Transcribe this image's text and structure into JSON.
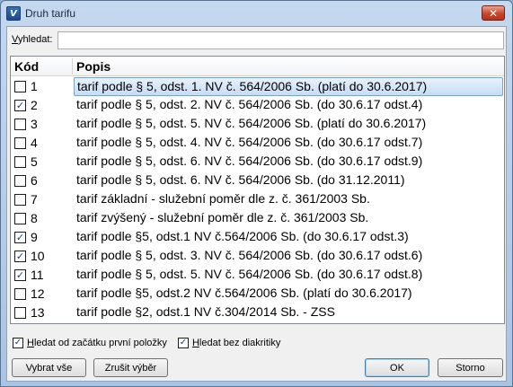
{
  "window": {
    "title": "Druh tarifu",
    "app_icon": "V",
    "close_glyph": "✕"
  },
  "search": {
    "label_prefix": "V",
    "label_rest": "yhledat:",
    "value": ""
  },
  "columns": {
    "kod": "Kód",
    "popis": "Popis"
  },
  "rows": [
    {
      "kod": "1",
      "popis": "tarif podle § 5, odst. 1. NV č. 564/2006 Sb. (platí do 30.6.2017)",
      "checked": false,
      "selected": true
    },
    {
      "kod": "2",
      "popis": "tarif podle § 5, odst. 2. NV č. 564/2006 Sb. (do 30.6.17 odst.4)",
      "checked": true,
      "selected": false
    },
    {
      "kod": "3",
      "popis": "tarif podle § 5, odst. 5. NV č. 564/2006 Sb. (platí do 30.6.2017)",
      "checked": false,
      "selected": false
    },
    {
      "kod": "4",
      "popis": "tarif podle § 5, odst. 4. NV č. 564/2006 Sb. (do 30.6.17 odst.7)",
      "checked": false,
      "selected": false
    },
    {
      "kod": "5",
      "popis": "tarif podle § 5, odst. 6. NV č. 564/2006 Sb. (do 30.6.17 odst.9)",
      "checked": false,
      "selected": false
    },
    {
      "kod": "6",
      "popis": "tarif podle § 5, odst. 6. NV č. 564/2006 Sb. (do 31.12.2011)",
      "checked": false,
      "selected": false
    },
    {
      "kod": "7",
      "popis": "tarif základní - služební poměr dle z. č. 361/2003 Sb.",
      "checked": false,
      "selected": false
    },
    {
      "kod": "8",
      "popis": "tarif zvýšený - služební poměr dle z. č. 361/2003 Sb.",
      "checked": false,
      "selected": false
    },
    {
      "kod": "9",
      "popis": "tarif podle §5, odst.1 NV č.564/2006 Sb. (do 30.6.17 odst.3)",
      "checked": true,
      "selected": false
    },
    {
      "kod": "10",
      "popis": "tarif podle § 5, odst. 3. NV č. 564/2006 Sb. (do 30.6.17 odst.6)",
      "checked": true,
      "selected": false
    },
    {
      "kod": "11",
      "popis": "tarif podle § 5, odst. 5. NV č. 564/2006 Sb. (do 30.6.17 odst.8)",
      "checked": true,
      "selected": false
    },
    {
      "kod": "12",
      "popis": "tarif podle §5, odst.2 NV č.564/2006 Sb. (platí do 30.6.2017)",
      "checked": false,
      "selected": false
    },
    {
      "kod": "13",
      "popis": "tarif podle §2, odst.1 NV č.304/2014 Sb. - ZSS",
      "checked": false,
      "selected": false
    }
  ],
  "options": {
    "from_start": {
      "label_prefix": "H",
      "label_rest": "ledat od začátku první položky",
      "checked": true
    },
    "no_diacritics": {
      "label_prefix": "H",
      "label_rest": "ledat bez diakritiky",
      "checked": true
    }
  },
  "buttons": {
    "select_all": "Vybrat vše",
    "clear_selection": "Zrušit výběr",
    "ok": "OK",
    "cancel": "Storno"
  },
  "colors": {
    "check": "#1f3f7a",
    "selection_border": "#7da2ce"
  }
}
